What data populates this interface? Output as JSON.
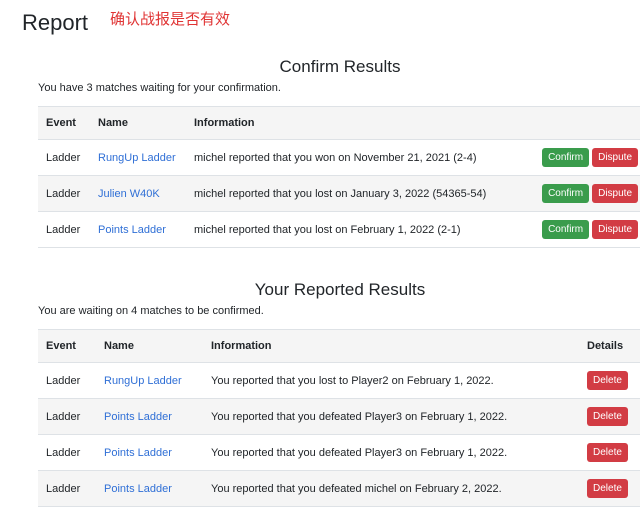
{
  "header": {
    "title": "Report",
    "annotation": "确认战报是否有效"
  },
  "confirm": {
    "title": "Confirm Results",
    "subtitle": "You have 3 matches waiting for your confirmation.",
    "columns": [
      "Event",
      "Name",
      "Information"
    ],
    "rows": [
      {
        "event": "Ladder",
        "name": "RungUp Ladder",
        "info": "michel reported that you won on November 21, 2021 (2-4)"
      },
      {
        "event": "Ladder",
        "name": "Julien W40K",
        "info": "michel reported that you lost on January 3, 2022 (54365-54)"
      },
      {
        "event": "Ladder",
        "name": "Points Ladder",
        "info": "michel reported that you lost on February 1, 2022 (2-1)"
      }
    ],
    "confirm_label": "Confirm",
    "dispute_label": "Dispute"
  },
  "reported": {
    "title": "Your Reported Results",
    "subtitle": "You are waiting on 4 matches to be confirmed.",
    "columns": [
      "Event",
      "Name",
      "Information",
      "Details"
    ],
    "rows": [
      {
        "event": "Ladder",
        "name": "RungUp Ladder",
        "info": "You reported that you lost to Player2 on February 1, 2022."
      },
      {
        "event": "Ladder",
        "name": "Points Ladder",
        "info": "You reported that you defeated Player3 on February 1, 2022."
      },
      {
        "event": "Ladder",
        "name": "Points Ladder",
        "info": "You reported that you defeated Player3 on February 1, 2022."
      },
      {
        "event": "Ladder",
        "name": "Points Ladder",
        "info": "You reported that you defeated michel on February 2, 2022."
      }
    ],
    "delete_label": "Delete"
  }
}
